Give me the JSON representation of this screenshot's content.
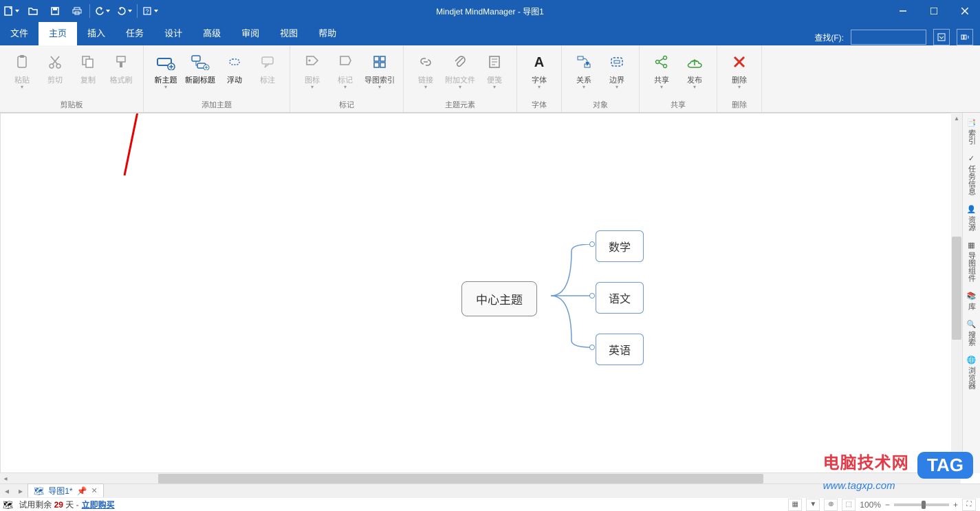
{
  "app": {
    "title": "Mindjet MindManager - 导图1"
  },
  "qat": {
    "new": "新建",
    "open": "打开",
    "save": "保存",
    "print": "打印",
    "undo": "撤销",
    "redo": "重做",
    "help": "帮助"
  },
  "tabs": {
    "items": [
      "文件",
      "主页",
      "插入",
      "任务",
      "设计",
      "高级",
      "审阅",
      "视图",
      "帮助"
    ],
    "active_index": 1
  },
  "search": {
    "label": "查找(F):"
  },
  "ribbon": {
    "groups": [
      {
        "title": "剪贴板",
        "buttons": [
          {
            "label": "粘贴",
            "icon": "paste",
            "drop": true,
            "disabled": true
          },
          {
            "label": "剪切",
            "icon": "cut",
            "disabled": true
          },
          {
            "label": "复制",
            "icon": "copy",
            "disabled": true
          },
          {
            "label": "格式刷",
            "icon": "format-painter",
            "disabled": true
          }
        ]
      },
      {
        "title": "添加主题",
        "buttons": [
          {
            "label": "新主题",
            "icon": "new-topic",
            "drop": true,
            "bold": true
          },
          {
            "label": "新副标题",
            "icon": "new-subtopic",
            "bold": true
          },
          {
            "label": "浮动",
            "icon": "floating",
            "bold": true
          },
          {
            "label": "标注",
            "icon": "callout",
            "disabled": true
          }
        ]
      },
      {
        "title": "标记",
        "buttons": [
          {
            "label": "图标",
            "icon": "tag-icon",
            "drop": true,
            "disabled": true
          },
          {
            "label": "标记",
            "icon": "marker",
            "drop": true,
            "disabled": true
          },
          {
            "label": "导图索引",
            "icon": "index",
            "drop": true
          }
        ]
      },
      {
        "title": "主题元素",
        "buttons": [
          {
            "label": "链接",
            "icon": "link",
            "drop": true,
            "disabled": true
          },
          {
            "label": "附加文件",
            "icon": "attach",
            "drop": true,
            "disabled": true
          },
          {
            "label": "便笺",
            "icon": "notes",
            "drop": true,
            "disabled": true
          }
        ]
      },
      {
        "title": "字体",
        "buttons": [
          {
            "label": "字体",
            "icon": "font",
            "drop": true
          }
        ]
      },
      {
        "title": "对象",
        "buttons": [
          {
            "label": "关系",
            "icon": "relation",
            "drop": true
          },
          {
            "label": "边界",
            "icon": "boundary",
            "drop": true
          }
        ]
      },
      {
        "title": "共享",
        "buttons": [
          {
            "label": "共享",
            "icon": "share",
            "drop": true
          },
          {
            "label": "发布",
            "icon": "publish",
            "drop": true
          }
        ]
      },
      {
        "title": "删除",
        "buttons": [
          {
            "label": "删除",
            "icon": "delete",
            "drop": true
          }
        ]
      }
    ]
  },
  "sidepane": {
    "items": [
      "索引",
      "任务信息",
      "资源",
      "导图组件",
      "库",
      "搜索",
      "浏览器"
    ]
  },
  "mindmap": {
    "center": "中心主题",
    "children": [
      "数学",
      "语文",
      "英语"
    ]
  },
  "doc_tab": {
    "name": "导图1*",
    "pinned": false
  },
  "status": {
    "trial_prefix": "试用剩余 ",
    "trial_days": "29",
    "trial_suffix": " 天 - ",
    "buy": "立即购买",
    "zoom": "100%"
  },
  "watermark": {
    "line1": "电脑技术网",
    "tag": "TAG",
    "line2": "www.tagxp.com"
  }
}
